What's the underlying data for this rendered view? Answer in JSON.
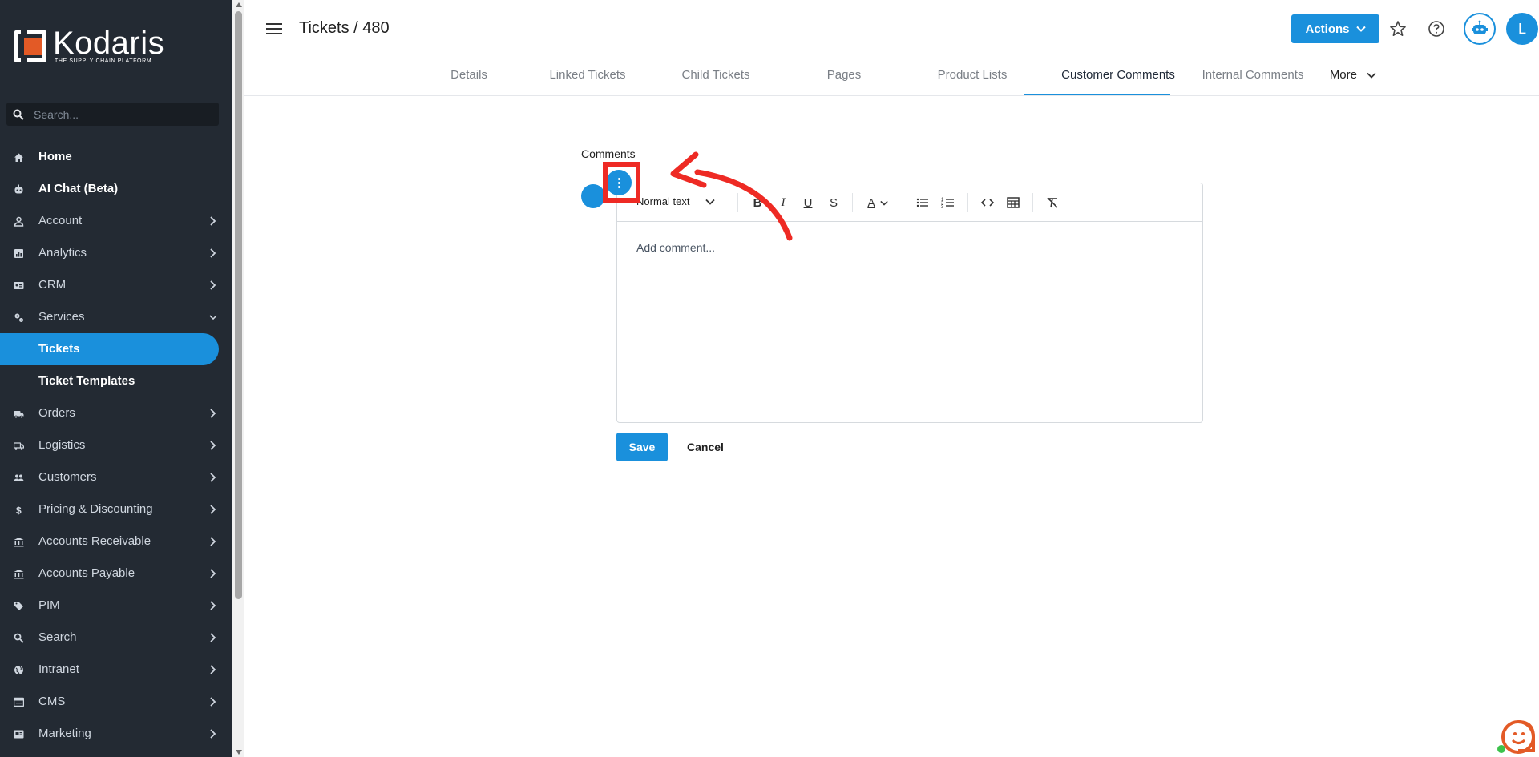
{
  "app": {
    "brand_name": "Kodaris",
    "brand_tagline": "THE SUPPLY CHAIN PLATFORM",
    "page_title": "Tickets / 480"
  },
  "sidebar": {
    "search_placeholder": "Search...",
    "items": [
      {
        "label": "Home",
        "icon": "home-icon"
      },
      {
        "label": "AI Chat (Beta)",
        "icon": "robot-icon"
      },
      {
        "label": "Account",
        "icon": "person-icon"
      },
      {
        "label": "Analytics",
        "icon": "chart-icon"
      },
      {
        "label": "CRM",
        "icon": "contact-card-icon"
      },
      {
        "label": "Services",
        "icon": "gears-icon"
      },
      {
        "label": "Tickets"
      },
      {
        "label": "Ticket Templates"
      },
      {
        "label": "Orders",
        "icon": "truck-icon"
      },
      {
        "label": "Logistics",
        "icon": "delivery-truck-icon"
      },
      {
        "label": "Customers",
        "icon": "people-icon"
      },
      {
        "label": "Pricing & Discounting",
        "icon": "dollar-icon"
      },
      {
        "label": "Accounts Receivable",
        "icon": "bank-icon"
      },
      {
        "label": "Accounts Payable",
        "icon": "bank-icon"
      },
      {
        "label": "PIM",
        "icon": "tag-icon"
      },
      {
        "label": "Search",
        "icon": "search-icon"
      },
      {
        "label": "Intranet",
        "icon": "globe-icon"
      },
      {
        "label": "CMS",
        "icon": "browser-icon"
      },
      {
        "label": "Marketing",
        "icon": "campaign-icon"
      }
    ]
  },
  "header": {
    "actions_label": "Actions",
    "avatar_initial": "L"
  },
  "tabs": [
    {
      "label": "Details"
    },
    {
      "label": "Linked Tickets"
    },
    {
      "label": "Child Tickets"
    },
    {
      "label": "Pages"
    },
    {
      "label": "Product Lists"
    },
    {
      "label": "Customer Comments",
      "active": true
    },
    {
      "label": "Internal Comments"
    },
    {
      "label": "More"
    }
  ],
  "comments": {
    "section_label": "Comments",
    "format_select": "Normal text",
    "placeholder": "Add comment...",
    "save_label": "Save",
    "cancel_label": "Cancel"
  },
  "colors": {
    "accent": "#1a90dc",
    "sidebar_bg": "#232a33",
    "annotation_red": "#ee2a24",
    "brand_orange": "#e35a26"
  }
}
